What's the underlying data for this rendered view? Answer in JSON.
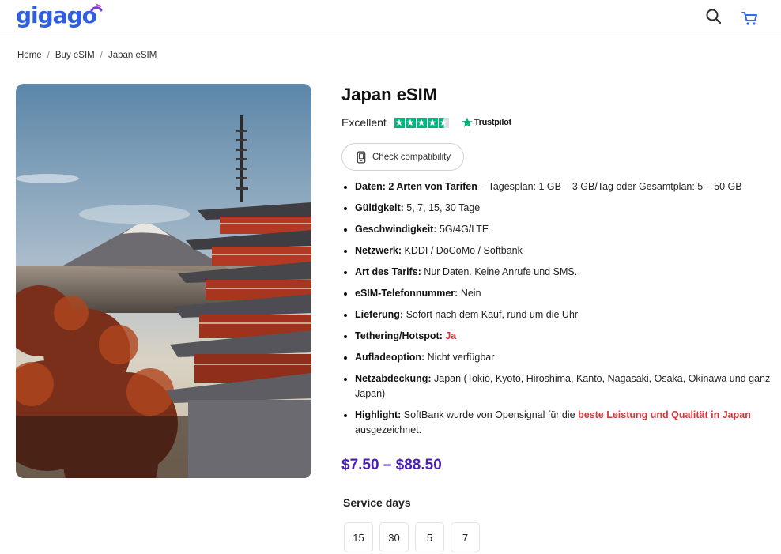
{
  "header": {
    "logo_text": "gigago",
    "brand_color": "#2f5fe0"
  },
  "breadcrumb": {
    "items": [
      "Home",
      "Buy eSIM",
      "Japan eSIM"
    ],
    "separator": "/"
  },
  "product": {
    "title": "Japan eSIM",
    "rating_label": "Excellent",
    "rating_stars": 4.5,
    "trustpilot_label": "Trustpilot",
    "compat_button": "Check compatibility",
    "features": [
      {
        "label": "Daten: 2 Arten von Tarifen",
        "text": " – Tagesplan: 1 GB – 3 GB/Tag oder Gesamtplan: 5 – 50 GB"
      },
      {
        "label": "Gültigkeit:",
        "text": " 5, 7, 15, 30 Tage"
      },
      {
        "label": "Geschwindigkeit:",
        "text": " 5G/4G/LTE"
      },
      {
        "label": "Netzwerk:",
        "text": " KDDI / DoCoMo / Softbank"
      },
      {
        "label": "Art des Tarifs:",
        "text": " Nur Daten. Keine Anrufe und SMS."
      },
      {
        "label": "eSIM-Telefonnummer:",
        "text": " Nein"
      },
      {
        "label": "Lieferung:",
        "text": " Sofort nach dem Kauf, rund um die Uhr"
      },
      {
        "label": "Tethering/Hotspot:",
        "text": " ",
        "highlight": "Ja"
      },
      {
        "label": "Aufladeoption:",
        "text": " Nicht verfügbar"
      },
      {
        "label": "Netzabdeckung:",
        "text": " Japan (Tokio, Kyoto, Hiroshima, Kanto, Nagasaki, Osaka, Okinawa und ganz Japan)"
      },
      {
        "label": "Highlight:",
        "text": " SoftBank wurde von Opensignal für die ",
        "highlight": "beste Leistung und Qualität in Japan",
        "text_after": " ausgezeichnet."
      }
    ],
    "price": "$7.50 – $88.50",
    "price_color": "#4a1fb8",
    "service_days_label": "Service days",
    "service_days": [
      "15",
      "30",
      "5",
      "7"
    ]
  }
}
